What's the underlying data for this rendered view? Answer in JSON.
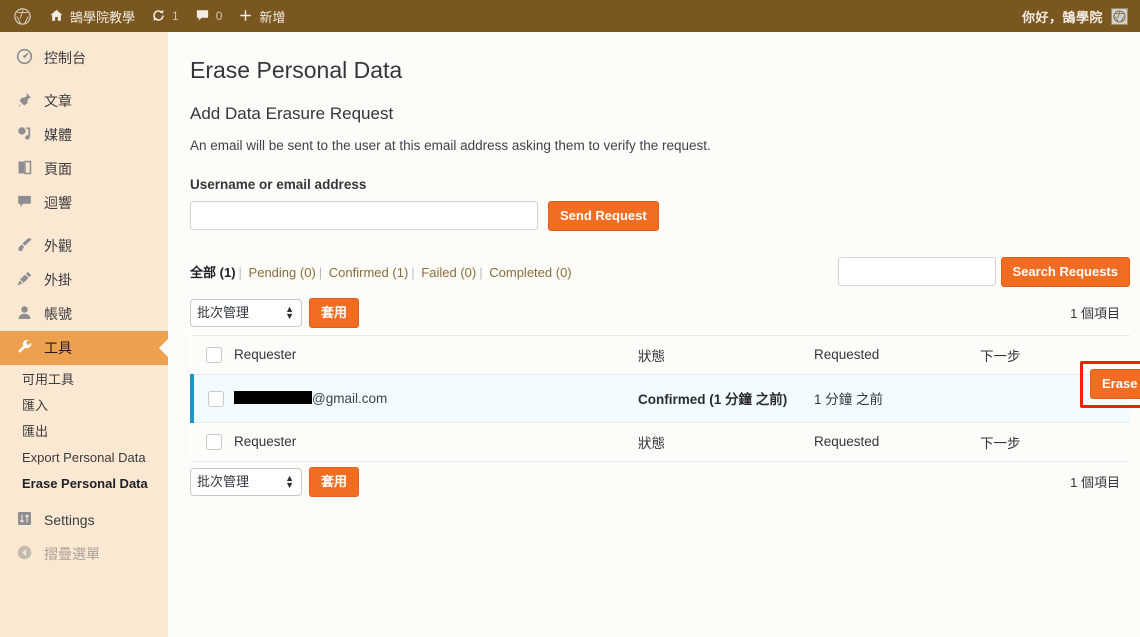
{
  "adminbar": {
    "logo_icon": "wordpress-logo-icon",
    "site_name": "鵠學院教學",
    "home_icon": "home-icon",
    "updates_icon": "updates-icon",
    "updates_count": "1",
    "comments_icon": "comment-icon",
    "comments_count": "0",
    "new_icon": "plus-icon",
    "new_label": "新增",
    "greeting": "你好，鵠學院",
    "avatar_icon": "avatar-icon"
  },
  "sidebar": {
    "items": [
      {
        "label": "控制台",
        "icon": "dashboard-icon"
      },
      {
        "label": "文章",
        "icon": "pin-icon"
      },
      {
        "label": "媒體",
        "icon": "media-icon"
      },
      {
        "label": "頁面",
        "icon": "page-icon"
      },
      {
        "label": "迴響",
        "icon": "comment-icon"
      },
      {
        "label": "外觀",
        "icon": "appearance-brush-icon"
      },
      {
        "label": "外掛",
        "icon": "plugin-icon"
      },
      {
        "label": "帳號",
        "icon": "user-icon"
      },
      {
        "label": "工具",
        "icon": "tools-wrench-icon"
      },
      {
        "label": "Settings",
        "icon": "settings-icon"
      }
    ],
    "submenu": [
      {
        "label": "可用工具"
      },
      {
        "label": "匯入"
      },
      {
        "label": "匯出"
      },
      {
        "label": "Export Personal Data"
      },
      {
        "label": "Erase Personal Data"
      }
    ],
    "collapse": {
      "label": "摺疊選單",
      "icon": "collapse-arrow-icon"
    }
  },
  "main": {
    "page_title": "Erase Personal Data",
    "section_title": "Add Data Erasure Request",
    "description": "An email will be sent to the user at this email address asking them to verify the request.",
    "form": {
      "label": "Username or email address",
      "input_value": "",
      "input_placeholder": "",
      "submit_label": "Send Request"
    },
    "filters": [
      {
        "label": "全部",
        "count": "(1)",
        "current": true
      },
      {
        "label": "Pending",
        "count": "(0)",
        "current": false
      },
      {
        "label": "Confirmed",
        "count": "(1)",
        "current": false
      },
      {
        "label": "Failed",
        "count": "(0)",
        "current": false
      },
      {
        "label": "Completed",
        "count": "(0)",
        "current": false
      }
    ],
    "search": {
      "value": "",
      "placeholder": "",
      "button_label": "Search Requests"
    },
    "bulk": {
      "selected": "批次管理",
      "options": [
        "批次管理"
      ],
      "apply_label": "套用"
    },
    "item_count": "1 個項目",
    "table": {
      "columns": [
        "Requester",
        "狀態",
        "Requested",
        "下一步"
      ],
      "rows": [
        {
          "requester_redacted": true,
          "requester_email_suffix": "@gmail.com",
          "status": "Confirmed (1 分鐘 之前)",
          "requested": "1 分鐘 之前",
          "next_step_label": "Erase Personal Data"
        }
      ]
    }
  },
  "colors": {
    "adminbar_bg": "#7a5621",
    "sidebar_bg": "#fbe8d2",
    "accent_orange": "#f26c21",
    "menu_current_bg": "#eda14f",
    "highlight_row_bg": "#f2fbff",
    "highlight_row_border": "#1e97c6",
    "annotation_red": "#f42000",
    "content_bg": "#fdfcf8"
  }
}
